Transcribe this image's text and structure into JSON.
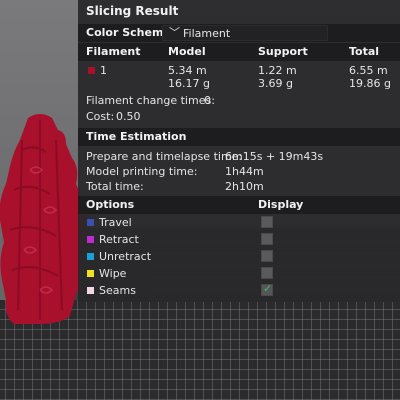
{
  "panel": {
    "title": "Slicing Result",
    "color_scheme": {
      "label": "Color Scheme",
      "value": "Filament"
    },
    "filament_table": {
      "headers": [
        "Filament",
        "Model",
        "Support",
        "Total"
      ],
      "rows": [
        {
          "id": "1",
          "color": "#a8102c",
          "model_length": "5.34 m",
          "model_weight": "16.17 g",
          "support_length": "1.22 m",
          "support_weight": "3.69 g",
          "total_length": "6.55 m",
          "total_weight": "19.86 g"
        }
      ]
    },
    "filament_change": {
      "label": "Filament change times:",
      "value": "0"
    },
    "cost": {
      "label": "Cost:",
      "value": "0.50"
    },
    "time_estimation": {
      "title": "Time Estimation",
      "rows": [
        {
          "label": "Prepare and timelapse time:",
          "value": "6m15s + 19m43s"
        },
        {
          "label": "Model printing time:",
          "value": "1h44m"
        },
        {
          "label": "Total time:",
          "value": "2h10m"
        }
      ]
    },
    "options": {
      "title": "Options",
      "display_title": "Display",
      "items": [
        {
          "label": "Travel",
          "color": "#3a4fb0",
          "checked": false
        },
        {
          "label": "Retract",
          "color": "#c02ad0",
          "checked": false
        },
        {
          "label": "Unretract",
          "color": "#1aa0d8",
          "checked": false
        },
        {
          "label": "Wipe",
          "color": "#f0e020",
          "checked": false
        },
        {
          "label": "Seams",
          "color": "#f0d8e0",
          "checked": true
        }
      ]
    }
  },
  "model_color": "#a8102c"
}
